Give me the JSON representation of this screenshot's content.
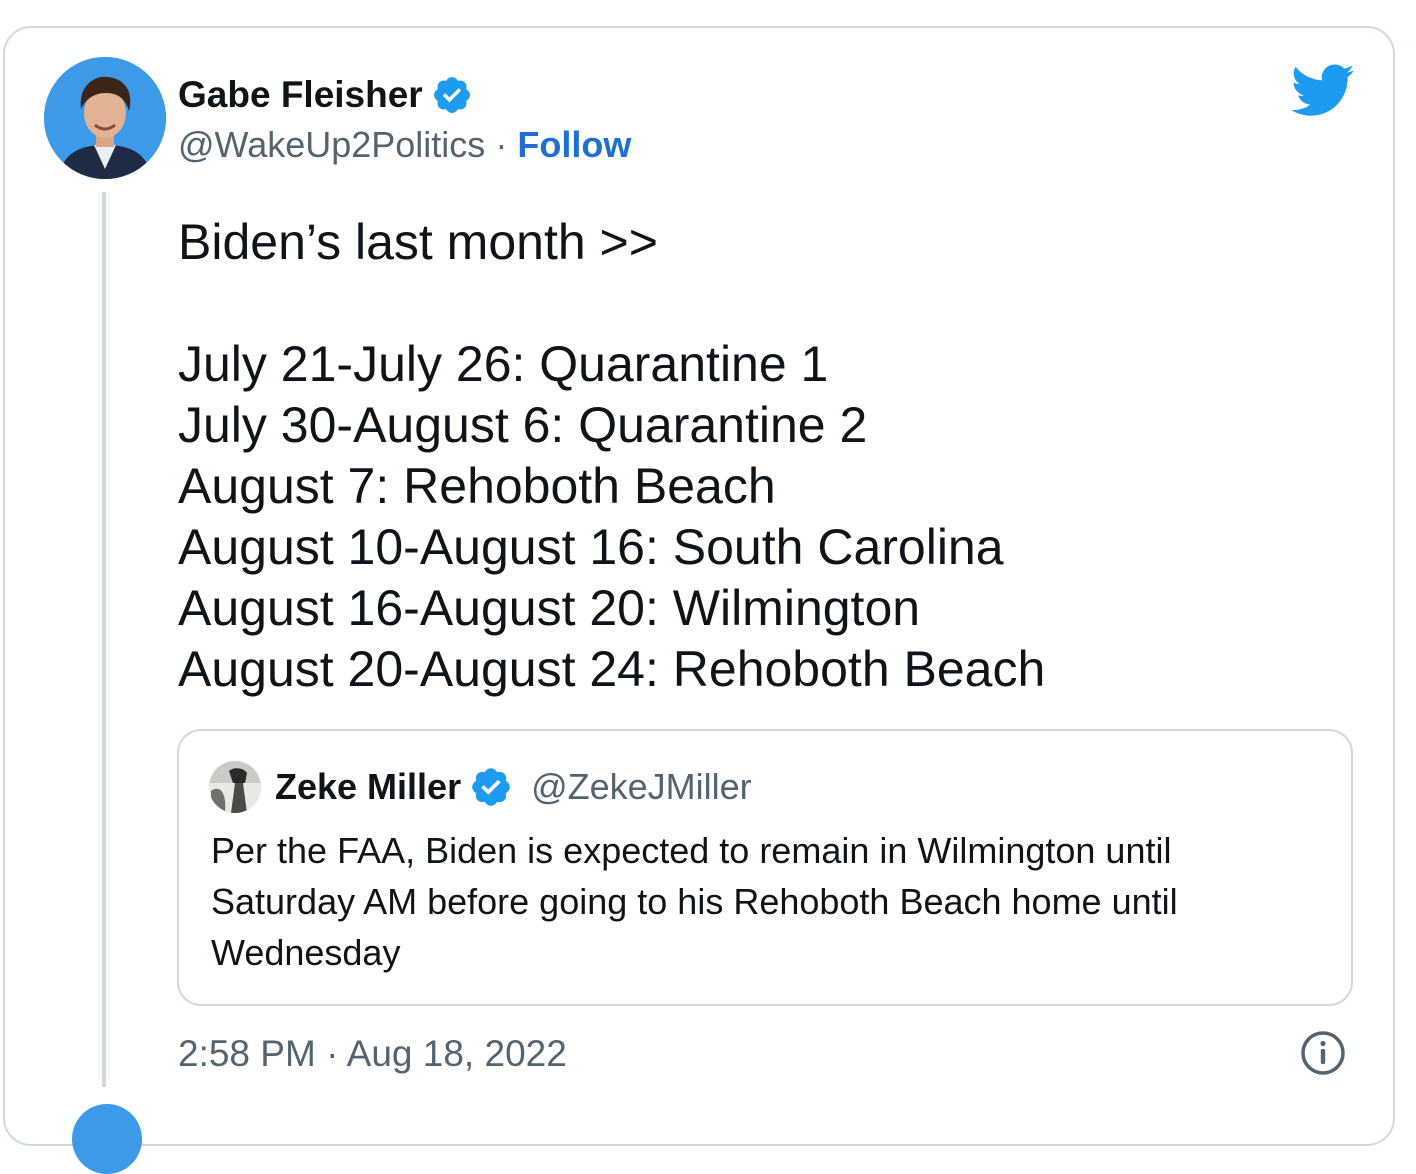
{
  "author": {
    "name": "Gabe Fleisher",
    "handle": "@WakeUp2Politics",
    "separator": "·",
    "follow_label": "Follow",
    "verified_icon": "verified-badge-icon",
    "avatar": "profile-photo"
  },
  "tweet": {
    "text": "Biden’s last month >>\n\nJuly 21-July 26: Quarantine 1\nJuly 30-August 6: Quarantine 2\nAugust 7: Rehoboth Beach\nAugust 10-August 16: South Carolina\nAugust 16-August 20: Wilmington\nAugust 20-August 24: Rehoboth Beach",
    "time": "2:58 PM",
    "date": "Aug 18, 2022",
    "meta_separator": "·"
  },
  "quoted_tweet": {
    "name": "Zeke Miller",
    "handle": "@ZekeJMiller",
    "text": "Per the FAA, Biden is expected to remain in Wilmington until Saturday AM before going to his Rehoboth Beach home until Wednesday"
  },
  "icons": {
    "brand": "twitter-bird-icon",
    "info": "info-icon"
  },
  "colors": {
    "link": "#1d6fd1",
    "twitter_blue": "#1d9bf0",
    "secondary_text": "#536471",
    "border": "#cfd9de",
    "verified": "#1d9bf0"
  }
}
